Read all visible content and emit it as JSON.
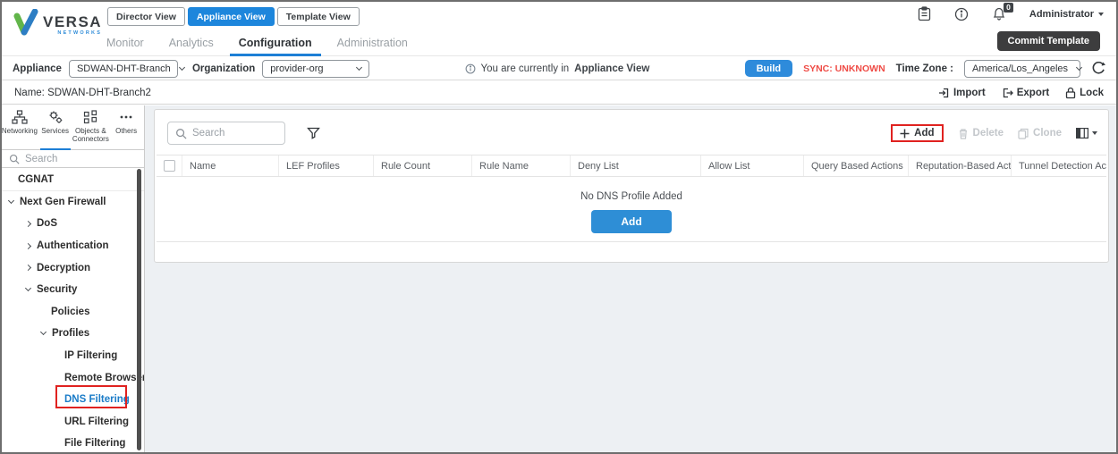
{
  "brand": {
    "name": "VERSA",
    "sub": "NETWORKS"
  },
  "view_switcher": {
    "items": [
      {
        "label": "Director View"
      },
      {
        "label": "Appliance View"
      },
      {
        "label": "Template View"
      }
    ],
    "active": "Appliance View"
  },
  "topbar": {
    "notification_count": "0",
    "user": "Administrator"
  },
  "nav": {
    "items": [
      {
        "label": "Monitor"
      },
      {
        "label": "Analytics"
      },
      {
        "label": "Configuration"
      },
      {
        "label": "Administration"
      }
    ],
    "active": "Configuration",
    "commit_label": "Commit Template"
  },
  "appliance_bar": {
    "appliance_label": "Appliance",
    "appliance_value": "SDWAN-DHT-Branch",
    "organization_label": "Organization",
    "organization_value": "provider-org",
    "notice_prefix": "You are currently in",
    "notice_bold": "Appliance View",
    "build_label": "Build",
    "sync_status": "SYNC: UNKNOWN",
    "timezone_label": "Time Zone :",
    "timezone_value": "America/Los_Angeles"
  },
  "name_bar": {
    "title": "Name: SDWAN-DHT-Branch2",
    "import_label": "Import",
    "export_label": "Export",
    "lock_label": "Lock"
  },
  "sidebar": {
    "tabs": [
      {
        "label": "Networking"
      },
      {
        "label": "Services"
      },
      {
        "label": "Objects & Connectors"
      },
      {
        "label": "Others"
      }
    ],
    "active_tab": "Services",
    "search_placeholder": "Search",
    "items": [
      {
        "label": "CGNAT"
      },
      {
        "label": "Next Gen Firewall"
      },
      {
        "label": "DoS"
      },
      {
        "label": "Authentication"
      },
      {
        "label": "Decryption"
      },
      {
        "label": "Security"
      },
      {
        "label": "Policies"
      },
      {
        "label": "Profiles"
      },
      {
        "label": "IP Filtering"
      },
      {
        "label": "Remote Browser..."
      },
      {
        "label": "DNS Filtering"
      },
      {
        "label": "URL Filtering"
      },
      {
        "label": "File Filtering"
      }
    ],
    "active_item": "DNS Filtering"
  },
  "main": {
    "search_placeholder": "Search",
    "toolbar": {
      "add_label": "Add",
      "delete_label": "Delete",
      "clone_label": "Clone"
    },
    "table": {
      "columns": [
        "Name",
        "LEF Profiles",
        "Rule Count",
        "Rule Name",
        "Deny List",
        "Allow List",
        "Query Based Actions",
        "Reputation-Based Actions",
        "Tunnel Detection Action"
      ]
    },
    "empty_state": {
      "message": "No DNS Profile Added",
      "add_label": "Add"
    }
  },
  "colors": {
    "accent_blue": "#1d86dc",
    "add_button_blue": "#2e8ed6",
    "commit_dark": "#3d3d3e",
    "sync_red": "#ef4b45",
    "annotation_red": "#e02220",
    "active_link_blue": "#1b7cc8"
  }
}
